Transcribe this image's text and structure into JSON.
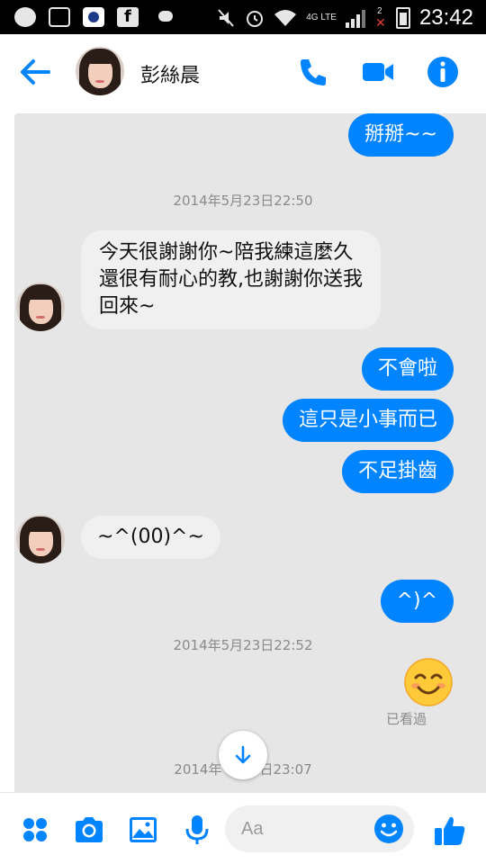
{
  "status_bar": {
    "time": "23:42",
    "network": "4G LTE",
    "sim": "2",
    "icons": [
      "line-icon",
      "gallery-icon",
      "kkbox-icon",
      "facebook-icon",
      "weather-icon",
      "chat-icon",
      "mute-icon",
      "alarm-icon",
      "wifi-icon",
      "signal-icon",
      "battery-icon"
    ]
  },
  "header": {
    "contact_name": "彭絲晨",
    "icons": [
      "back-arrow-icon",
      "phone-icon",
      "video-icon",
      "info-icon"
    ]
  },
  "colors": {
    "accent": "#0084ff",
    "incoming_bubble": "#f1f0f0",
    "timestamp": "#8a8a8a"
  },
  "messages": [
    {
      "type": "outgoing",
      "text": "掰掰~~"
    },
    {
      "type": "timestamp",
      "text": "2014年5月23日22:50"
    },
    {
      "type": "incoming",
      "lines": [
        "今天很謝謝你~陪我練這麼久",
        "還很有耐心的教,也謝謝你送我",
        "回來~"
      ]
    },
    {
      "type": "outgoing",
      "text": "不會啦"
    },
    {
      "type": "outgoing",
      "text": "這只是小事而已"
    },
    {
      "type": "outgoing",
      "text": "不足掛齒"
    },
    {
      "type": "incoming",
      "text": "~^(00)^~"
    },
    {
      "type": "outgoing",
      "text": "^)^"
    },
    {
      "type": "timestamp",
      "text": "2014年5月23日22:52"
    },
    {
      "type": "outgoing_emoji",
      "emoji": "smiling-face-emoji"
    },
    {
      "type": "seen",
      "text": "已看過"
    },
    {
      "type": "timestamp_partial",
      "left": "2014年",
      "right": "日23:07"
    }
  ],
  "composer": {
    "placeholder": "Aa",
    "icons": [
      "apps-icon",
      "camera-icon",
      "image-icon",
      "mic-icon",
      "emoji-icon",
      "thumbs-up-icon"
    ]
  },
  "scroll_button": {
    "icon": "arrow-down-icon"
  }
}
